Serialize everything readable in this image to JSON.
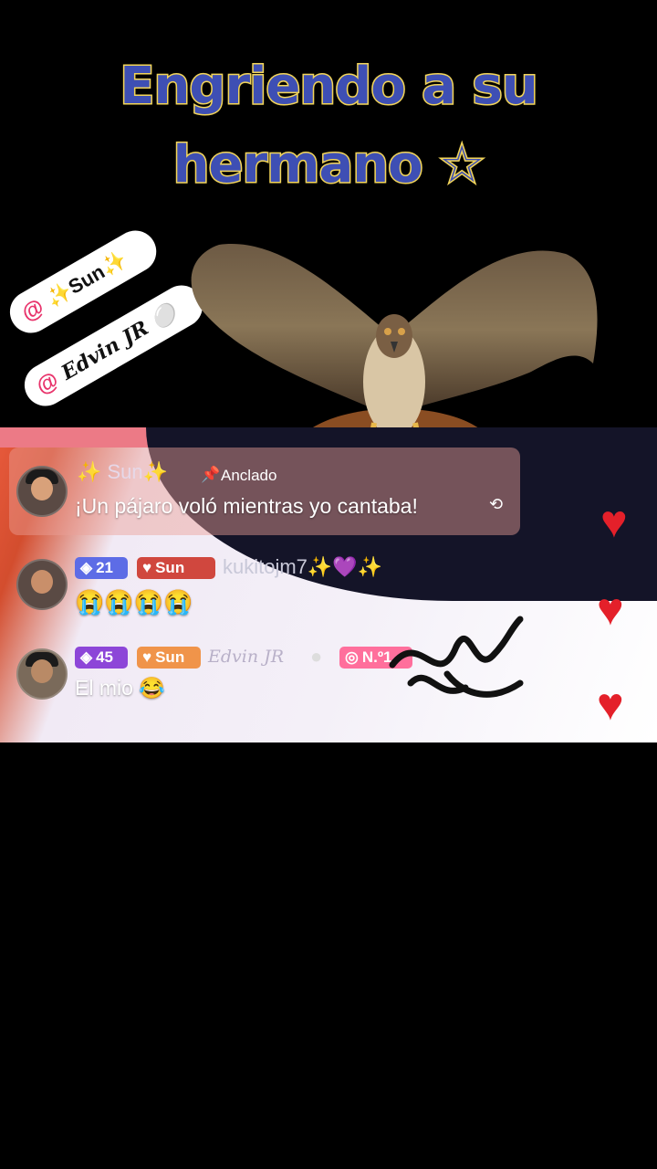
{
  "overlay": {
    "title_line1": "Engriendo a su",
    "title_line2": "hermano ☆",
    "tags": [
      {
        "at": "@",
        "name": "✨Sun✨"
      },
      {
        "at": "@",
        "name": "Edvin JR ⚪"
      }
    ]
  },
  "live": {
    "pinned": {
      "username": "✨ Sun✨",
      "pin_label": "Anclado",
      "message": "¡Un pájaro voló mientras yo cantaba!",
      "translate_icon": "translate-icon"
    },
    "comments": [
      {
        "level": "21",
        "fan_badge": "Sun",
        "username": "kukitojm7✨💜✨",
        "message": "😭😭😭😭"
      },
      {
        "level": "45",
        "fan_badge": "Sun",
        "username": "Edvin JR",
        "rank_badge": "N.º1",
        "message": "El mio 😂"
      }
    ],
    "hearts": 3
  },
  "colors": {
    "title_fill": "#3e4fb4",
    "title_outline": "#f2d55a",
    "at_color": "#e8336b",
    "heart": "#e4202a"
  }
}
